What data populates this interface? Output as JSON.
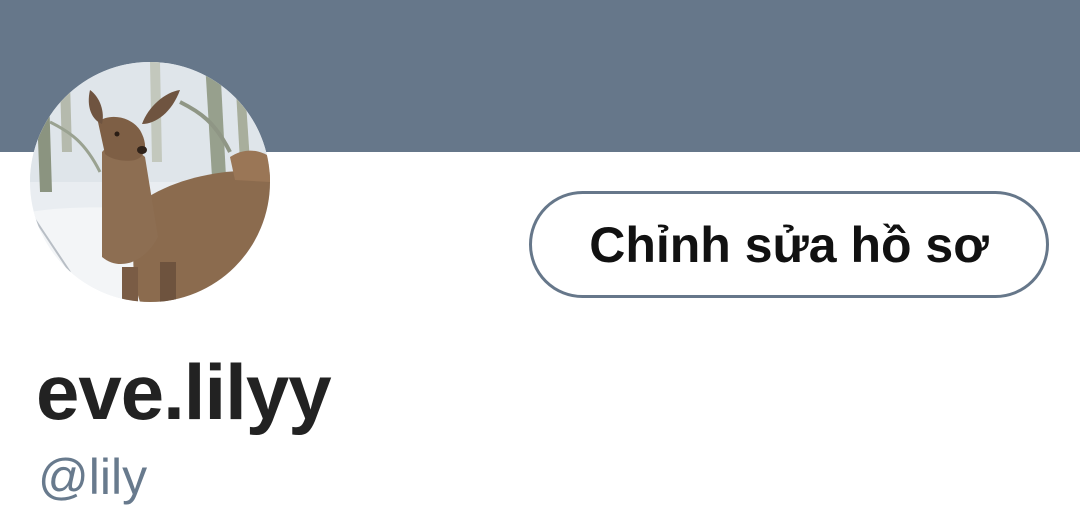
{
  "colors": {
    "banner": "#66778a",
    "button_border": "#66778a",
    "handle_text": "#687a8d",
    "name_text": "#222222"
  },
  "profile": {
    "avatar_icon": "deer-photo-avatar",
    "display_name": "eve.lilyy",
    "handle": "@lily"
  },
  "actions": {
    "edit_profile_label": "Chỉnh sửa hồ sơ"
  }
}
